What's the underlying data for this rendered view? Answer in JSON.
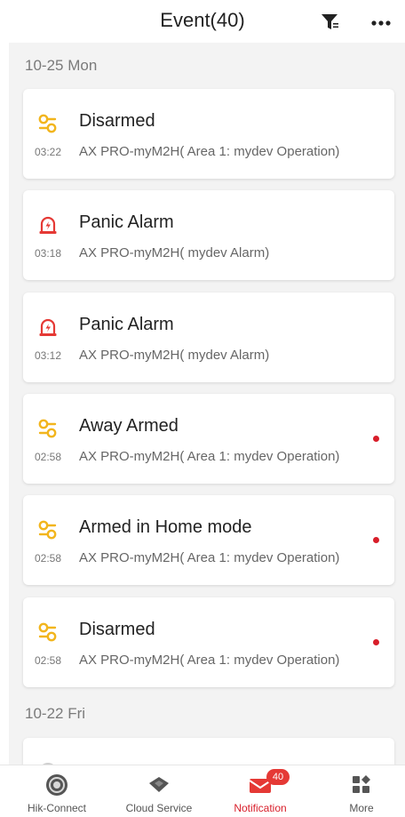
{
  "header": {
    "title": "Event(40)"
  },
  "colors": {
    "accent": "#d81e2a",
    "armed_icon": "#f2b51d",
    "alarm_icon": "#e53935"
  },
  "groups": [
    {
      "date": "10-25 Mon",
      "events": [
        {
          "icon": "arm-status-icon",
          "title": "Disarmed",
          "time": "03:22",
          "desc": "AX PRO-myM2H( Area 1: mydev Operation)",
          "unread": false
        },
        {
          "icon": "panic-alarm-icon",
          "title": "Panic Alarm",
          "time": "03:18",
          "desc": "AX PRO-myM2H( mydev Alarm)",
          "unread": false
        },
        {
          "icon": "panic-alarm-icon",
          "title": "Panic Alarm",
          "time": "03:12",
          "desc": "AX PRO-myM2H( mydev Alarm)",
          "unread": false
        },
        {
          "icon": "arm-status-icon",
          "title": "Away Armed",
          "time": "02:58",
          "desc": "AX PRO-myM2H( Area 1: mydev Operation)",
          "unread": true
        },
        {
          "icon": "arm-status-icon",
          "title": "Armed in Home mode",
          "time": "02:58",
          "desc": "AX PRO-myM2H( Area 1: mydev Operation)",
          "unread": true
        },
        {
          "icon": "arm-status-icon",
          "title": "Disarmed",
          "time": "02:58",
          "desc": "AX PRO-myM2H( Area 1: mydev Operation)",
          "unread": true
        }
      ]
    },
    {
      "date": "10-22 Fri"
    }
  ],
  "tabbar": {
    "tabs": [
      {
        "label": "Hik-Connect",
        "icon": "hik-connect-icon"
      },
      {
        "label": "Cloud Service",
        "icon": "cloud-service-icon"
      },
      {
        "label": "Notification",
        "icon": "mail-icon",
        "badge": "40",
        "active": true
      },
      {
        "label": "More",
        "icon": "more-grid-icon"
      }
    ]
  }
}
